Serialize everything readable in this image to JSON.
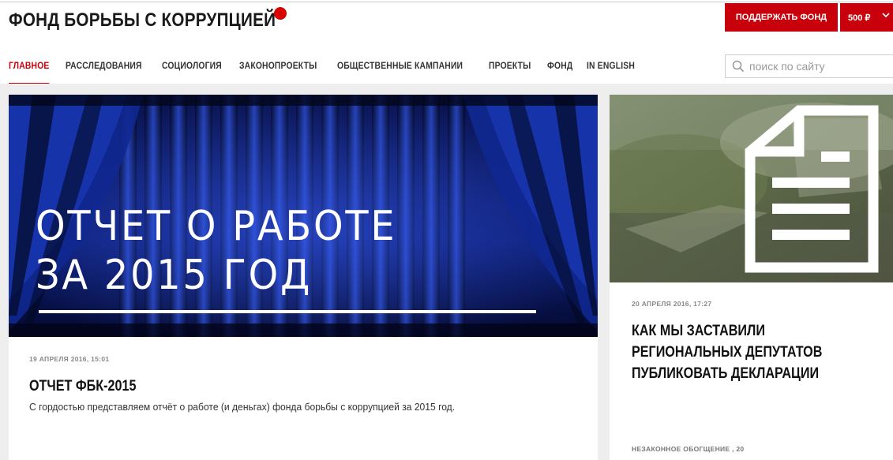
{
  "header": {
    "logo_text": "ФОНД БОРЬБЫ С КОРРУПЦИЕЙ",
    "support_label": "ПОДДЕРЖАТЬ ФОНД",
    "amount_label": "500 ₽",
    "accent_color": "#c8000b"
  },
  "nav": {
    "items": [
      {
        "label": "ГЛАВНОЕ",
        "active": true
      },
      {
        "label": "РАССЛЕДОВАНИЯ"
      },
      {
        "label": "СОЦИОЛОГИЯ"
      },
      {
        "label": "ЗАКОНОПРОЕКТЫ"
      },
      {
        "label": "ОБЩЕСТВЕННЫЕ КАМПАНИИ"
      },
      {
        "label": "ПРОЕКТЫ"
      },
      {
        "label": "ФОНД"
      },
      {
        "label": "IN ENGLISH"
      }
    ]
  },
  "search": {
    "placeholder": "поиск по сайту",
    "icon": "search-icon"
  },
  "main_article": {
    "image_title": "ОТЧЕТ О РАБОТЕ\nЗА 2015 ГОД",
    "date": "19 АПРЕЛЯ 2016, 15:01",
    "headline": "ОТЧЕТ ФБК-2015",
    "lead": "С гордостью представляем отчёт о работе (и деньгах) фонда борьбы с коррупцией за 2015 год."
  },
  "side_article": {
    "icon": "document-icon",
    "date": "20 АПРЕЛЯ 2016, 17:27",
    "headline": "КАК МЫ ЗАСТАВИЛИ РЕГИОНАЛЬНЫХ ДЕПУТАТОВ ПУБЛИКОВАТЬ ДЕКЛАРАЦИИ",
    "tag": "НЕЗАКОННОЕ ОБОГЩЕНИЕ , 20"
  }
}
